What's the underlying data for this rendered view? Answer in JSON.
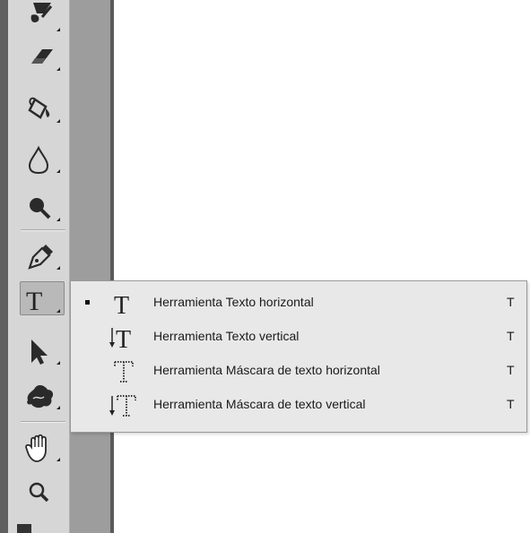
{
  "toolbar": {
    "tools": [
      {
        "name": "history-brush-tool"
      },
      {
        "name": "eraser-tool"
      },
      {
        "name": "paint-bucket-tool"
      },
      {
        "name": "blur-tool"
      },
      {
        "name": "dodge-tool"
      },
      {
        "name": "pen-tool"
      },
      {
        "name": "type-tool",
        "glyph": "T",
        "active": true
      },
      {
        "name": "path-selection-tool"
      },
      {
        "name": "custom-shape-tool"
      },
      {
        "name": "hand-tool"
      },
      {
        "name": "zoom-tool"
      }
    ]
  },
  "flyout": {
    "items": [
      {
        "label": "Herramienta Texto horizontal",
        "shortcut": "T",
        "selected": true,
        "icon": "horizontal-type-icon"
      },
      {
        "label": "Herramienta Texto vertical",
        "shortcut": "T",
        "selected": false,
        "icon": "vertical-type-icon"
      },
      {
        "label": "Herramienta Máscara de texto horizontal",
        "shortcut": "T",
        "selected": false,
        "icon": "horizontal-type-mask-icon"
      },
      {
        "label": "Herramienta Máscara de texto vertical",
        "shortcut": "T",
        "selected": false,
        "icon": "vertical-type-mask-icon"
      }
    ]
  },
  "colors": {
    "panel_bg": "#d6d6d6",
    "flyout_bg": "#e8e8e8",
    "gutter": "#9d9d9d",
    "dark_edge": "#5f5f5f"
  }
}
